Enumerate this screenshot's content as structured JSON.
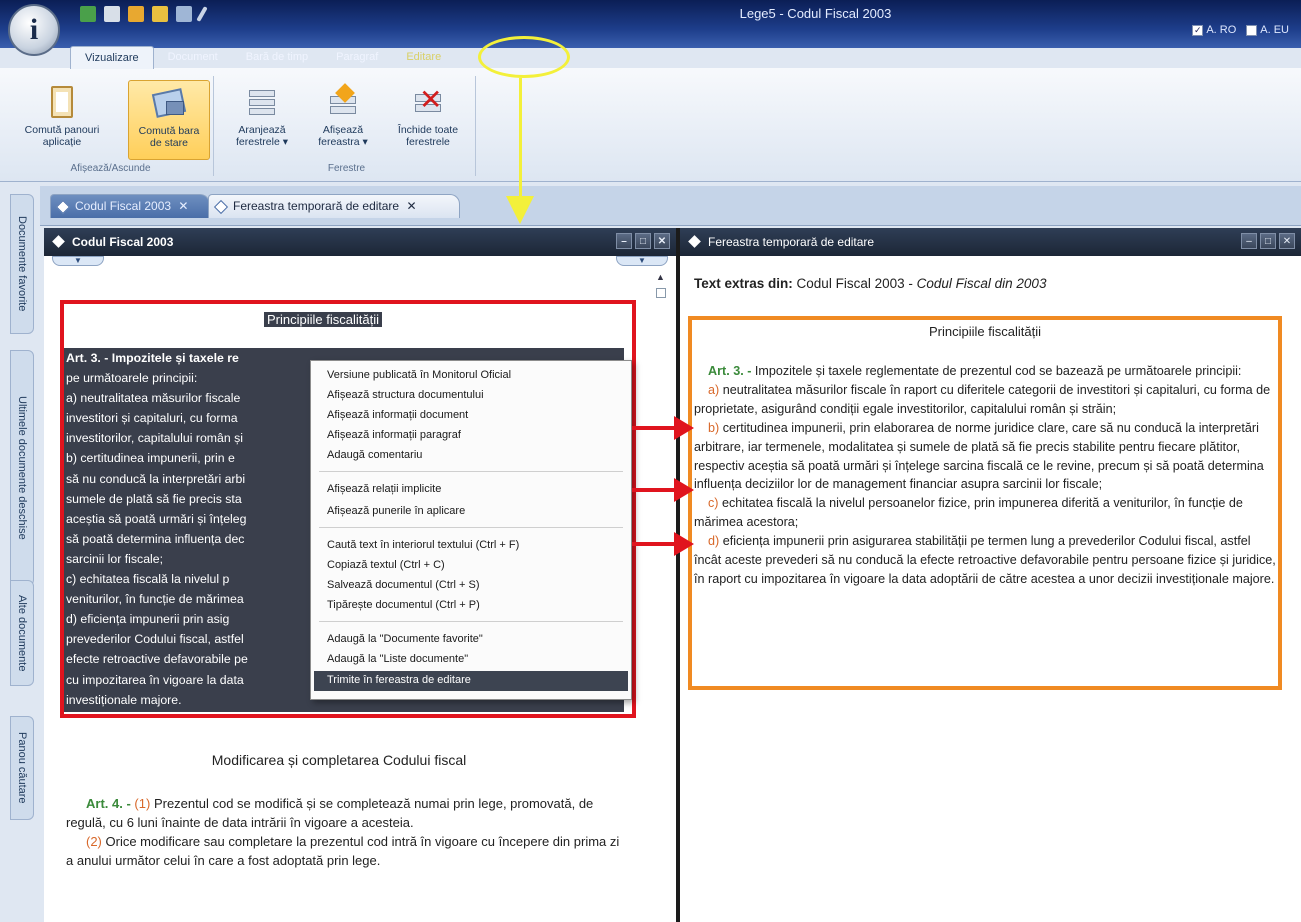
{
  "title_bar": {
    "app_title": "Lege5 - Codul Fiscal 2003",
    "orb_letter": "i",
    "lang_ro_label": "A. RO",
    "lang_eu_label": "A. EU"
  },
  "ribbon_tabs": [
    "Vizualizare",
    "Document",
    "Bară de timp",
    "Paragraf",
    "Editare"
  ],
  "ribbon": {
    "group_afiseaza": {
      "label": "Afișează/Ascunde",
      "btn1_line1": "Comută panouri",
      "btn1_line2": "aplicație",
      "btn2_line1": "Comută bara",
      "btn2_line2": "de stare"
    },
    "group_ferestre": {
      "label": "Ferestre",
      "btn1_line1": "Aranjează",
      "btn1_line2": "ferestrele ▾",
      "btn2_line1": "Afișează",
      "btn2_line2": "fereastra ▾",
      "btn3_line1": "Închide toate",
      "btn3_line2": "ferestrele"
    }
  },
  "side_tabs": [
    "Documente favorite",
    "Ultimele documente deschise",
    "Alte documente",
    "Panou căutare"
  ],
  "doc_tabs": [
    "Codul Fiscal 2003",
    "Fereastra temporară de editare"
  ],
  "left_pane": {
    "title": "Codul Fiscal 2003",
    "selected_heading": "Principiile fiscalității",
    "selected_lines": [
      "Art. 3. - Impozitele și taxele re",
      "pe următoarele principii:",
      "  a) neutralitatea măsurilor fiscale",
      "investitori și capitaluri, cu forma",
      "investitorilor, capitalului român și",
      "  b) certitudinea impunerii, prin e",
      "să nu conducă la interpretări arbi",
      "sumele de plată să fie precis sta",
      "aceștia să poată urmări și înțeleg",
      "să poată determina influența dec",
      "sarcinii lor fiscale;",
      "  c) echitatea fiscală la nivelul p",
      "veniturilor, în funcție de mărimea",
      "  d) eficiența impunerii prin asig",
      "prevederilor Codului fiscal, astfel",
      "efecte retroactive defavorabile pe",
      "cu impozitarea în vigoare la data",
      "investiționale majore."
    ],
    "section_heading": "Modificarea și completarea Codului fiscal",
    "art4_label": "Art. 4. -",
    "art4_p1_num": "(1)",
    "art4_p1": "Prezentul cod se modifică și se completează numai prin lege, promovată, de regulă, cu 6 luni înainte de data intrării în vigoare a acesteia.",
    "art4_p2_num": "(2)",
    "art4_p2": "Orice modificare sau completare la prezentul cod intră în vigoare cu începere din prima zi a anului următor celui în care a fost adoptată prin lege."
  },
  "context_menu": [
    "Versiune publicată în Monitorul Oficial",
    "Afișează structura documentului",
    "Afișează informații document",
    "Afișează informații paragraf",
    "Adaugă comentariu",
    "Afișează relații implicite",
    "Afișează punerile în aplicare",
    "Caută text în interiorul textului (Ctrl + F)",
    "Copiază textul (Ctrl + C)",
    "Salvează documentul (Ctrl + S)",
    "Tipărește documentul (Ctrl + P)",
    "Adaugă la \"Documente favorite\"",
    "Adaugă la \"Liste documente\"",
    "Trimite în fereastra de editare"
  ],
  "right_pane": {
    "title": "Fereastra temporară de editare",
    "source_label": "Text extras din:",
    "source_doc": "Codul Fiscal 2003 -",
    "source_italic": "Codul Fiscal din 2003",
    "heading": "Principiile fiscalității",
    "art_label": "Art. 3. -",
    "intro": "Impozitele și taxele reglementate de prezentul cod se bazează pe următoarele principii:",
    "a_letter": "a)",
    "a_text": "neutralitatea măsurilor fiscale în raport cu diferitele categorii de investitori și capitaluri, cu forma de proprietate, asigurând condiții egale investitorilor, capitalului român și străin;",
    "b_letter": "b)",
    "b_text": "certitudinea impunerii, prin elaborarea de norme juridice clare, care să nu conducă la interpretări arbitrare, iar termenele, modalitatea și sumele de plată să fie precis stabilite pentru fiecare plătitor, respectiv aceștia să poată urmări și înțelege sarcina fiscală ce le revine, precum și să poată determina influența deciziilor lor de management financiar asupra sarcinii lor fiscale;",
    "c_letter": "c)",
    "c_text": "echitatea fiscală la nivelul persoanelor fizice, prin impunerea diferită a veniturilor, în funcție de mărimea acestora;",
    "d_letter": "d)",
    "d_text": "eficiența impunerii prin asigurarea stabilității pe termen lung a prevederilor Codului fiscal, astfel încât aceste prevederi să nu conducă la efecte retroactive defavorabile pentru persoane fizice și juridice, în raport cu impozitarea în vigoare la data adoptării de către acestea a unor decizii investiționale majore."
  },
  "colors": {
    "annotation_yellow": "#f3f03a",
    "annotation_red": "#e0141e",
    "annotation_orange": "#f08a22",
    "article_green": "#3a8a3a"
  }
}
